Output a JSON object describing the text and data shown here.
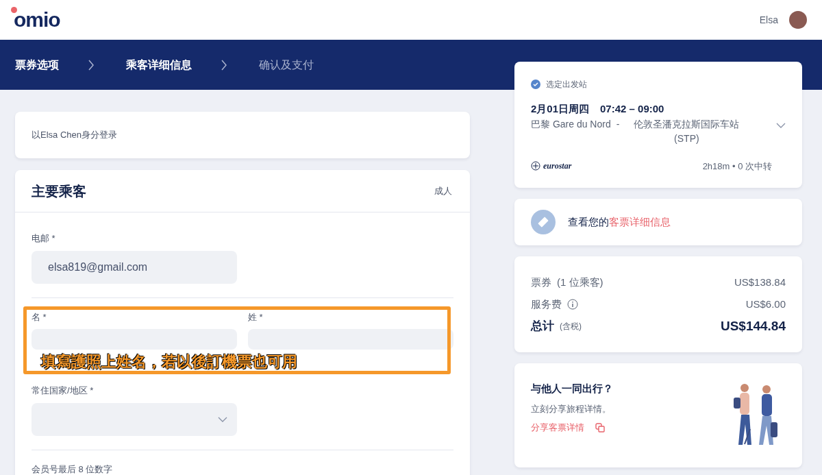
{
  "header": {
    "logo": "omio",
    "user_name": "Elsa"
  },
  "steps": [
    {
      "label": "票券选项",
      "active": true
    },
    {
      "label": "乘客详细信息",
      "active": true
    },
    {
      "label": "确认及支付",
      "active": false
    }
  ],
  "login_notice": "以Elsa Chen身分登录",
  "passenger": {
    "title": "主要乘客",
    "type": "成人",
    "fields": [
      {
        "kind": "text",
        "label": "电邮 *",
        "value": "elsa819@gmail.com"
      },
      {
        "kind": "pair",
        "items": [
          {
            "label": "名 *"
          },
          {
            "label": "姓 *"
          }
        ],
        "annotation": "填寫護照上姓名，若以後訂機票也可用"
      },
      {
        "kind": "select",
        "label": "常住国家/地区 *"
      },
      {
        "kind": "text",
        "label": "会员号最后 8 位数字"
      }
    ]
  },
  "journey": {
    "status": "选定出发站",
    "date": "2月01日周四",
    "time": "07:42 – 09:00",
    "from": "巴黎 Gare du Nord",
    "separator": "-",
    "to": "伦敦圣潘克拉斯国际车站 (STP)",
    "operator": "eurostar",
    "duration": "2h18m • 0 次中转"
  },
  "ticket_link": {
    "text": "查看您的",
    "link": "客票详细信息"
  },
  "prices": [
    {
      "kind": "line",
      "label": "票券",
      "note": "(1 位乘客)",
      "amount": "US$138.84"
    },
    {
      "kind": "fee",
      "label": "服务费",
      "amount": "US$6.00"
    },
    {
      "kind": "total",
      "label": "总计",
      "note": "(含税)",
      "amount": "US$144.84"
    }
  ],
  "share": {
    "title": "与他人一同出行？",
    "text": "立刻分享旅程详情。",
    "link": "分享客票详情"
  }
}
